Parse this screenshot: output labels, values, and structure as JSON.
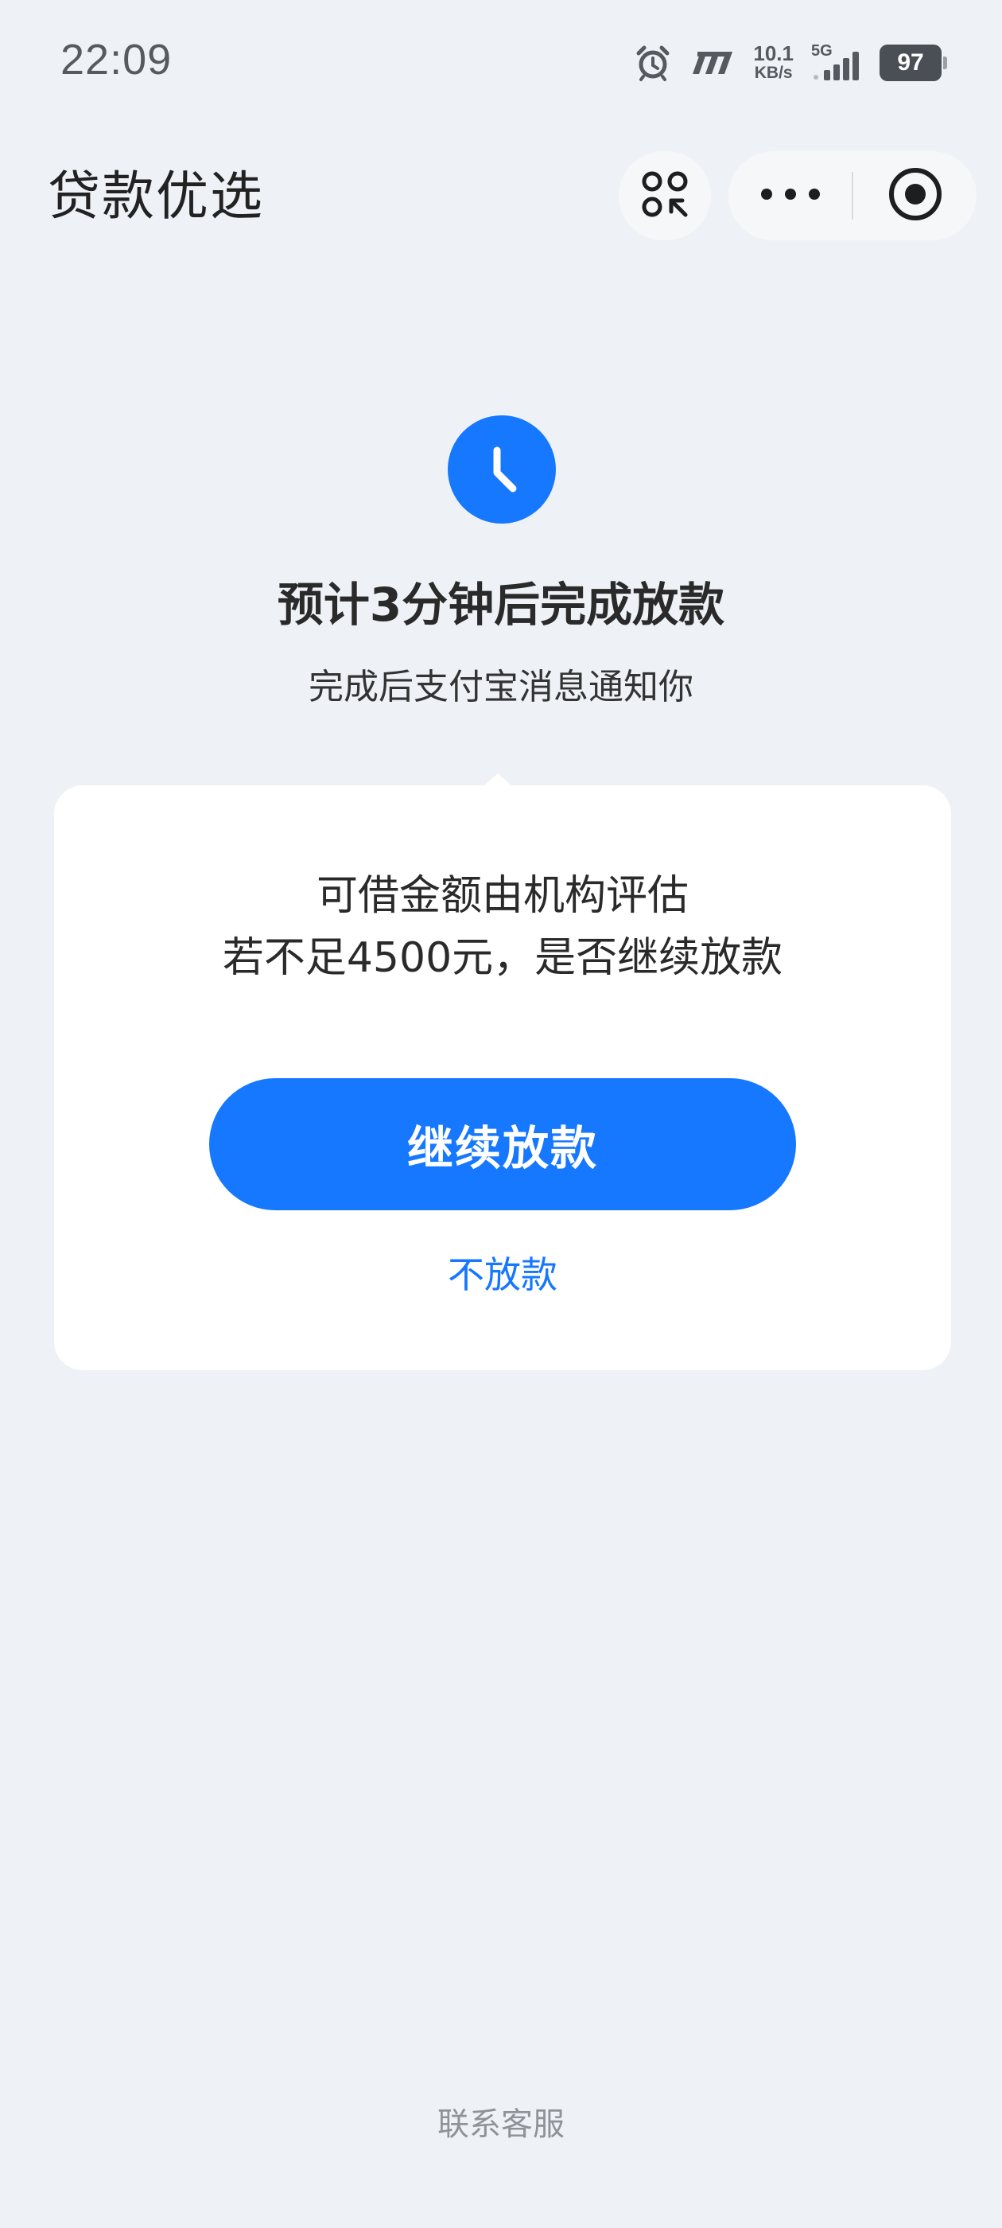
{
  "status_bar": {
    "time": "22:09",
    "net_speed_value": "10.1",
    "net_speed_unit": "KB/s",
    "network_type": "5G",
    "battery_level": "97",
    "icons": [
      "alarm-icon",
      "nfc-icon",
      "signal-icon",
      "battery-icon"
    ]
  },
  "nav": {
    "title": "贷款优选",
    "icons": [
      "mini-program-icon",
      "more-icon",
      "close-icon"
    ]
  },
  "status": {
    "icon": "clock-icon",
    "title": "预计3分钟后完成放款",
    "subtitle": "完成后支付宝消息通知你"
  },
  "card": {
    "message_line1": "可借金额由机构评估",
    "message_line2": "若不足4500元，是否继续放款",
    "continue_label": "继续放款",
    "decline_label": "不放款"
  },
  "footer": {
    "support_label": "联系客服"
  },
  "colors": {
    "accent": "#1677ff",
    "background": "#eef1f6",
    "card": "#ffffff",
    "muted_text": "#8f9399"
  }
}
